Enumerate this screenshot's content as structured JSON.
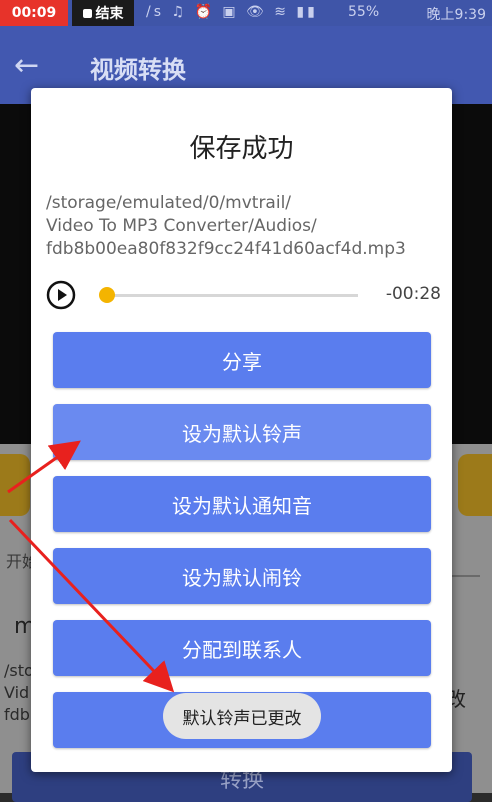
{
  "status_bar": {
    "time_badge": "00:09",
    "record_label": "结束",
    "icons_text": "/s ♫ ⏰ ▣ 👁 ≋ ▮▮",
    "battery": "55%",
    "clock": "晚上9:39"
  },
  "app_bar": {
    "title": "视频转换"
  },
  "background": {
    "label_partial": "开始",
    "item_initial": "m",
    "path_partial": "/sto\nVid\nfdb",
    "edit_partial": "改",
    "convert_button": "转换"
  },
  "dialog": {
    "title": "保存成功",
    "file_path": "/storage/emulated/0/mvtrail/\nVideo To MP3 Converter/Audios/\nfdb8b00ea80f832f9cc24f41d60acf4d.mp3",
    "player": {
      "time_remaining": "-00:28",
      "progress": 0
    },
    "buttons": {
      "share": "分享",
      "set_ringtone": "设为默认铃声",
      "set_notification": "设为默认通知音",
      "set_alarm": "设为默认闹铃",
      "assign_contact": "分配到联系人"
    },
    "toast": "默认铃声已更改"
  },
  "colors": {
    "accent": "#5a7dee",
    "seek_thumb": "#f4b400",
    "app_bar": "#4258b0",
    "annotation_arrow": "#e8211e"
  }
}
